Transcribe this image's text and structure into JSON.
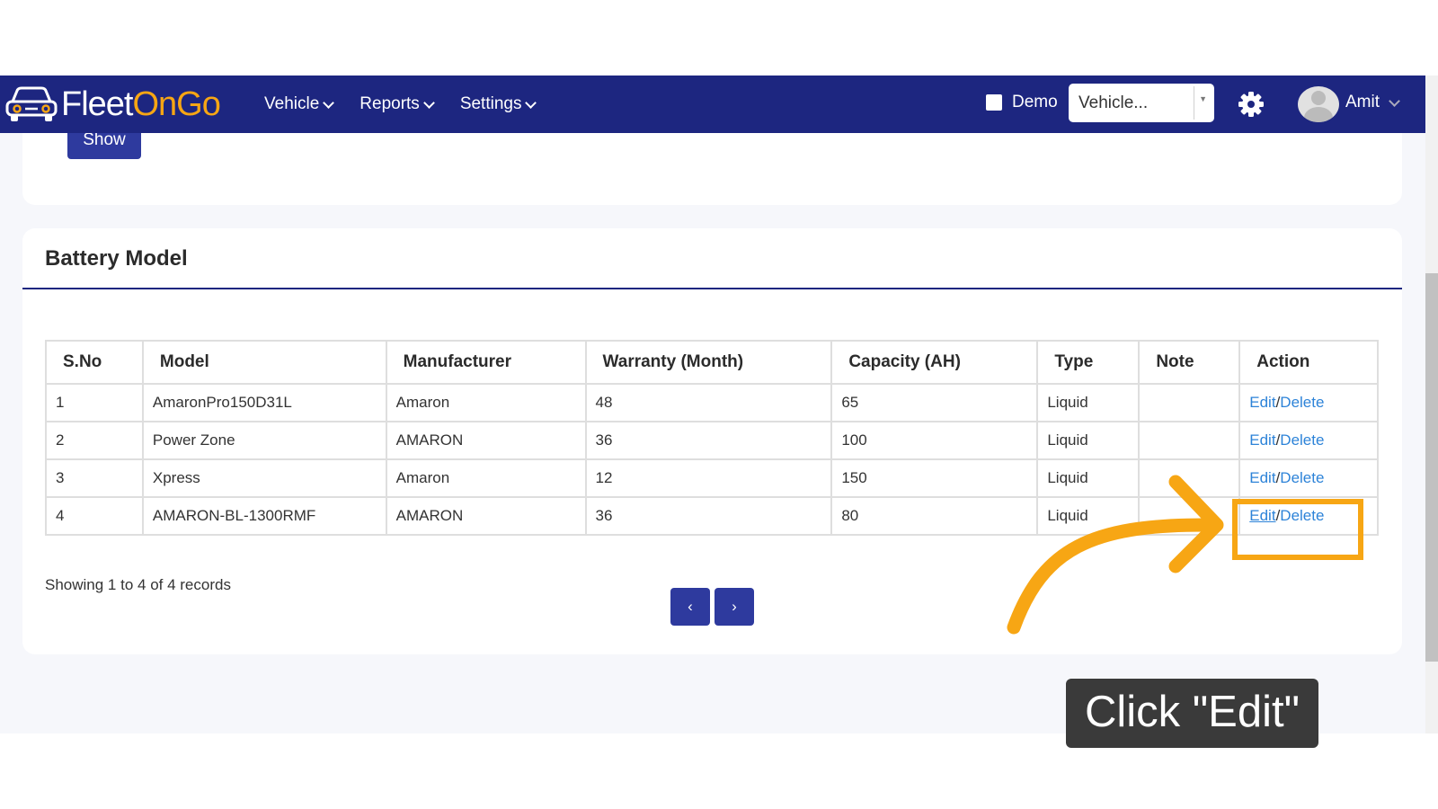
{
  "brand": {
    "part1": "Fleet",
    "part2": "OnGo"
  },
  "nav": {
    "items": [
      {
        "label": "Vehicle"
      },
      {
        "label": "Reports"
      },
      {
        "label": "Settings"
      }
    ]
  },
  "header": {
    "demo_label": "Demo",
    "vehicle_select_value": "Vehicle...",
    "user_name": "Amit"
  },
  "filters": {
    "show_label": "Show"
  },
  "battery_model": {
    "title": "Battery Model",
    "columns": [
      "S.No",
      "Model",
      "Manufacturer",
      "Warranty (Month)",
      "Capacity (AH)",
      "Type",
      "Note",
      "Action"
    ],
    "rows": [
      {
        "sno": "1",
        "model": "AmaronPro150D31L",
        "manufacturer": "Amaron",
        "warranty": "48",
        "capacity": "65",
        "type": "Liquid",
        "note": "",
        "edit": "Edit",
        "delete": "Delete"
      },
      {
        "sno": "2",
        "model": "Power Zone",
        "manufacturer": "AMARON",
        "warranty": "36",
        "capacity": "100",
        "type": "Liquid",
        "note": "",
        "edit": "Edit",
        "delete": "Delete"
      },
      {
        "sno": "3",
        "model": "Xpress",
        "manufacturer": "Amaron",
        "warranty": "12",
        "capacity": "150",
        "type": "Liquid",
        "note": "",
        "edit": "Edit",
        "delete": "Delete"
      },
      {
        "sno": "4",
        "model": "AMARON-BL-1300RMF",
        "manufacturer": "AMARON",
        "warranty": "36",
        "capacity": "80",
        "type": "Liquid",
        "note": "",
        "edit": "Edit",
        "delete": "Delete"
      }
    ],
    "records_text": "Showing 1 to 4 of 4 records",
    "prev_label": "‹",
    "next_label": "›"
  },
  "tutorial": {
    "callout_text": "Click \"Edit\"",
    "highlight_color": "#f7a614"
  }
}
